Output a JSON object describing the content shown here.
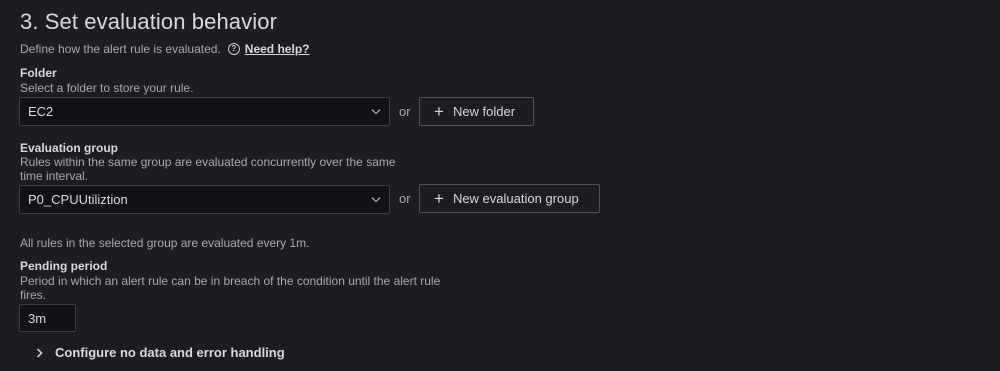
{
  "section": {
    "title": "3. Set evaluation behavior",
    "description": "Define how the alert rule is evaluated.",
    "help_link": "Need help?"
  },
  "folder": {
    "label": "Folder",
    "description": "Select a folder to store your rule.",
    "selected": "EC2",
    "or_text": "or",
    "new_button": "New folder"
  },
  "evaluation_group": {
    "label": "Evaluation group",
    "description_line1": "Rules within the same group are evaluated concurrently over the same",
    "description_line2": "time interval.",
    "selected": "P0_CPUUtiliztion",
    "or_text": "or",
    "new_button": "New evaluation group",
    "info": "All rules in the selected group are evaluated every 1m."
  },
  "pending_period": {
    "label": "Pending period",
    "description_line1": "Period in which an alert rule can be in breach of the condition until the alert rule",
    "description_line2": "fires.",
    "value": "3m"
  },
  "collapsible": {
    "label": "Configure no data and error handling"
  },
  "icons": {
    "help": "question-circle-icon",
    "dropdown": "chevron-down-icon",
    "add": "plus-icon",
    "expand": "chevron-right-icon"
  }
}
